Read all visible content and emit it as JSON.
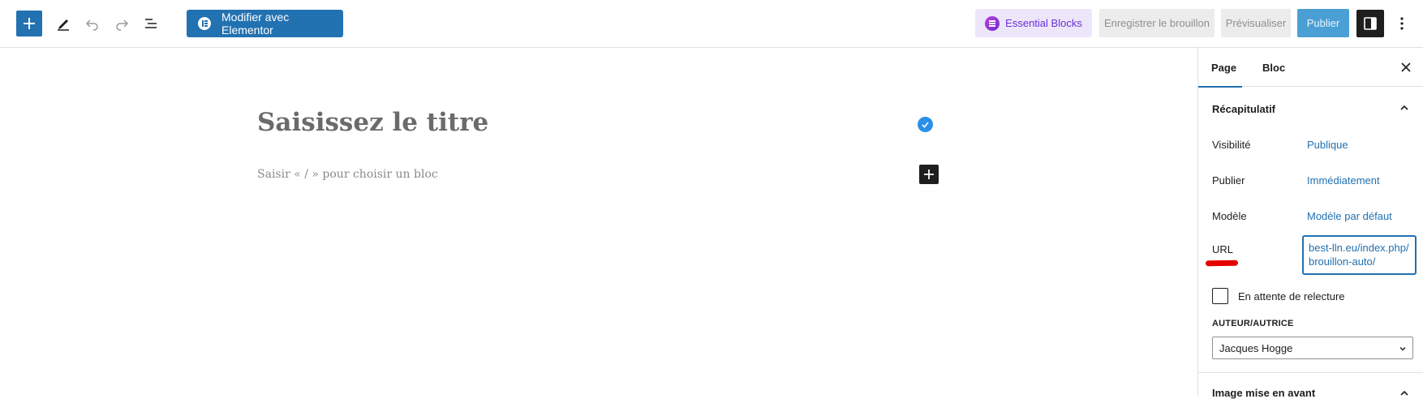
{
  "toolbar": {
    "inserter_icon": "plus-icon",
    "tools_icon": "pencil-icon",
    "undo_icon": "undo-icon",
    "redo_icon": "redo-icon",
    "outline_icon": "list-view-icon",
    "elementor_label": "Modifier avec Elementor",
    "essential_blocks_label": "Essential Blocks",
    "save_draft_label": "Enregistrer le brouillon",
    "preview_label": "Prévisualiser",
    "publish_label": "Publier",
    "settings_icon": "sidebar-toggle-icon",
    "more_icon": "more-vertical-icon",
    "accent_color": "#2271b1"
  },
  "editor": {
    "title_placeholder": "Saisissez le titre",
    "block_placeholder": "Saisir « / » pour choisir un bloc"
  },
  "sidebar": {
    "tabs": [
      {
        "label": "Page",
        "active": true
      },
      {
        "label": "Bloc",
        "active": false
      }
    ],
    "summary": {
      "heading": "Récapitulatif",
      "rows": [
        {
          "label": "Visibilité",
          "value": "Publique"
        },
        {
          "label": "Publier",
          "value": "Immédiatement"
        },
        {
          "label": "Modèle",
          "value": "Modèle par défaut"
        },
        {
          "label": "URL",
          "value": "best-lln.eu/index.php/brouillon-auto/"
        }
      ],
      "pending_review_label": "En attente de relecture",
      "pending_review_checked": false,
      "author_label": "AUTEUR/AUTRICE",
      "author_value": "Jacques Hogge"
    },
    "featured_image_heading": "Image mise en avant"
  }
}
